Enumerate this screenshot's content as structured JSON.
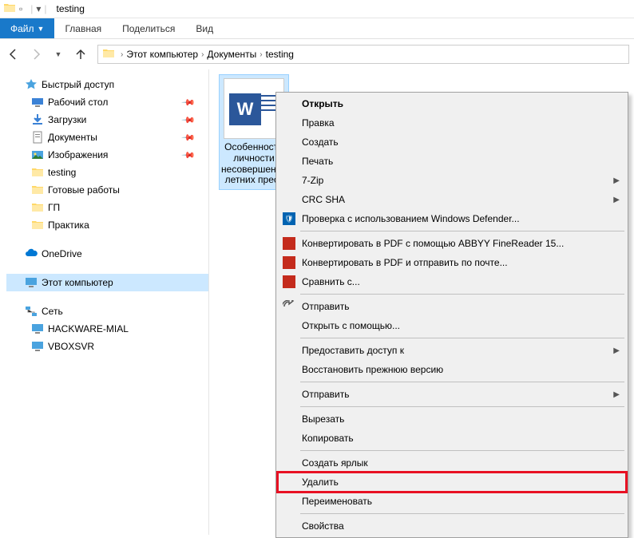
{
  "titlebar": {
    "title": "testing"
  },
  "ribbon": {
    "file": "Файл",
    "home": "Главная",
    "share": "Поделиться",
    "view": "Вид"
  },
  "breadcrumb": [
    "Этот компьютер",
    "Документы",
    "testing"
  ],
  "nav": {
    "quick_access": "Быстрый доступ",
    "items": [
      {
        "label": "Рабочий стол",
        "pinned": true
      },
      {
        "label": "Загрузки",
        "pinned": true
      },
      {
        "label": "Документы",
        "pinned": true
      },
      {
        "label": "Изображения",
        "pinned": true
      },
      {
        "label": "testing",
        "pinned": false
      },
      {
        "label": "Готовые работы",
        "pinned": false
      },
      {
        "label": "ГП",
        "pinned": false
      },
      {
        "label": "Практика",
        "pinned": false
      }
    ],
    "onedrive": "OneDrive",
    "this_pc": "Этот компьютер",
    "network": "Сеть",
    "net_items": [
      "HACKWARE-MIAL",
      "VBOXSVR"
    ]
  },
  "file": {
    "name": "Особенности личности несовершеннолетних прест"
  },
  "menu": {
    "open": "Открыть",
    "edit": "Правка",
    "new": "Создать",
    "print": "Печать",
    "sevenzip": "7-Zip",
    "crcsha": "CRC SHA",
    "defender": "Проверка с использованием Windows Defender...",
    "abbyy1": "Конвертировать в PDF с помощью ABBYY FineReader 15...",
    "abbyy2": "Конвертировать в PDF и отправить по почте...",
    "compare": "Сравнить с...",
    "send": "Отправить",
    "open_with": "Открыть с помощью...",
    "share_access": "Предоставить доступ к",
    "restore": "Восстановить прежнюю версию",
    "send_to": "Отправить",
    "cut": "Вырезать",
    "copy": "Копировать",
    "shortcut": "Создать ярлык",
    "delete": "Удалить",
    "rename": "Переименовать",
    "properties": "Свойства"
  }
}
